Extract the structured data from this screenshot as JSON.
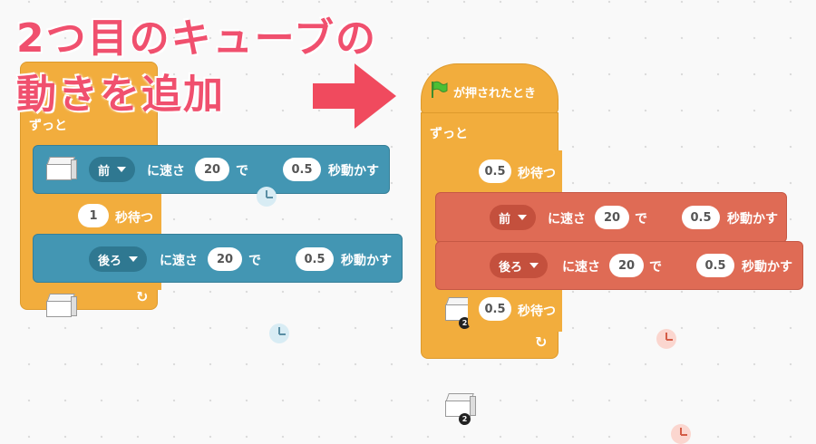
{
  "title": {
    "line1": "2つ目のキューブの",
    "line2": "動きを追加"
  },
  "left_script": {
    "forever_label": "ずっと",
    "move1": {
      "direction": "前",
      "speed_prefix": "に速さ",
      "speed": "20",
      "de": "で",
      "seconds": "0.5",
      "suffix": "秒動かす"
    },
    "wait1": {
      "seconds": "1",
      "suffix": "秒待つ"
    },
    "move2": {
      "direction": "後ろ",
      "speed_prefix": "に速さ",
      "speed": "20",
      "de": "で",
      "seconds": "0.5",
      "suffix": "秒動かす"
    }
  },
  "right_script": {
    "hat_label": "が押されたとき",
    "forever_label": "ずっと",
    "wait1": {
      "seconds": "0.5",
      "suffix": "秒待つ"
    },
    "move1": {
      "direction": "前",
      "speed_prefix": "に速さ",
      "speed": "20",
      "de": "で",
      "seconds": "0.5",
      "suffix": "秒動かす",
      "cube_badge": "2"
    },
    "move2": {
      "direction": "後ろ",
      "speed_prefix": "に速さ",
      "speed": "20",
      "de": "で",
      "seconds": "0.5",
      "suffix": "秒動かす",
      "cube_badge": "2"
    },
    "wait2": {
      "seconds": "0.5",
      "suffix": "秒待つ"
    }
  },
  "colors": {
    "control": "#f2ad3d",
    "motion_cube1": "#4396b3",
    "motion_cube2": "#df6b55",
    "title": "#f0506e",
    "arrow": "#f04a5e"
  },
  "icons": [
    "green-flag-icon",
    "cube-icon",
    "clock-icon",
    "caret-down-icon",
    "loop-arrow-icon",
    "right-arrow-icon"
  ]
}
